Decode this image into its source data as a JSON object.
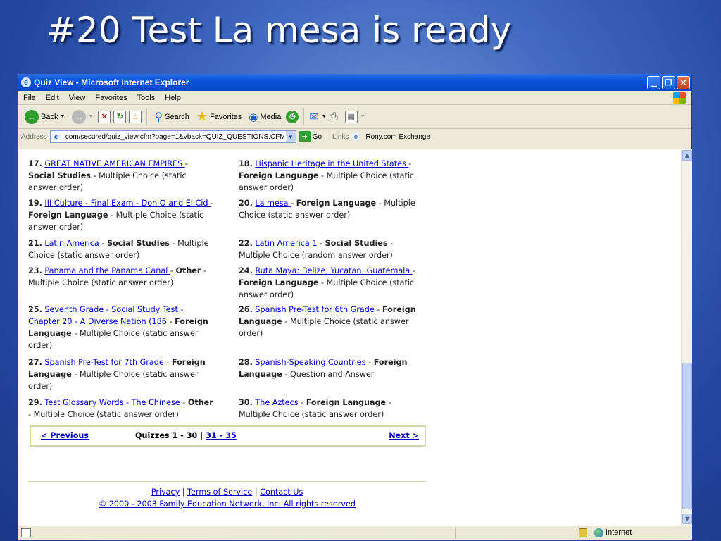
{
  "slide": {
    "title": "#20 Test La mesa is ready"
  },
  "window": {
    "title": "Quiz View - Microsoft Internet Explorer"
  },
  "menu": [
    "File",
    "Edit",
    "View",
    "Favorites",
    "Tools",
    "Help"
  ],
  "toolbar": {
    "back": "Back",
    "search": "Search",
    "favorites": "Favorites",
    "media": "Media"
  },
  "address": {
    "label": "Address",
    "url": "com/secured/quiz_view.cfm?page=1&vback=QUIZ_QUESTIONS.CFM",
    "go": "Go",
    "links": "Links",
    "exchange": "Rony.com Exchange"
  },
  "quizzes": [
    {
      "num": "17.",
      "title": "GREAT NATIVE AMERICAN EMPIRES ",
      "subject": "Social Studies",
      "type": "Multiple Choice (static answer order)"
    },
    {
      "num": "18.",
      "title": "Hispanic Heritage in the United States ",
      "subject": "Foreign Language",
      "type": "Multiple Choice (static answer order)"
    },
    {
      "num": "19.",
      "title": "III Culture - Final Exam - Don Q and El Cid ",
      "subject": "Foreign Language",
      "type": "Multiple Choice (static answer order)"
    },
    {
      "num": "20.",
      "title": "La mesa ",
      "subject": "Foreign Language",
      "type": "Multiple Choice (static answer order)"
    },
    {
      "num": "21.",
      "title": "Latin America ",
      "subject": "Social Studies",
      "type": "Multiple Choice (static answer order)"
    },
    {
      "num": "22.",
      "title": "Latin America 1 ",
      "subject": "Social Studies",
      "type": "Multiple Choice (random answer order)"
    },
    {
      "num": "23.",
      "title": "Panama and the Panama Canal ",
      "subject": "Other",
      "type": "Multiple Choice (static answer order)"
    },
    {
      "num": "24.",
      "title": "Ruta Maya: Belize, Yucatan, Guatemala ",
      "subject": "Foreign Language",
      "type": "Multiple Choice (static answer order)"
    },
    {
      "num": "25.",
      "title": "Seventh Grade - Social Study Test - Chapter 20 - A Diverse Nation (186 ",
      "subject": "Foreign Language",
      "type": "Multiple Choice (static answer order)"
    },
    {
      "num": "26.",
      "title": "Spanish Pre-Test for 6th Grade ",
      "subject": "Foreign Language",
      "type": "Multiple Choice (static answer order)"
    },
    {
      "num": "27.",
      "title": "Spanish Pre-Test for 7th Grade ",
      "subject": "Foreign Language",
      "type": "Multiple Choice (static answer order)"
    },
    {
      "num": "28.",
      "title": "Spanish-Speaking Countries ",
      "subject": "Foreign Language",
      "type": "Question and Answer"
    },
    {
      "num": "29.",
      "title": "Test Glossary Words - The Chinese ",
      "subject": "Other",
      "type": "Multiple Choice (static answer order)"
    },
    {
      "num": "30.",
      "title": "The Aztecs ",
      "subject": "Foreign Language",
      "type": "Multiple Choice (static answer order)"
    }
  ],
  "sep": "-",
  "pager": {
    "prev": "< Previous",
    "range": "Quizzes 1 - 30 |",
    "range_link": "31 - 35",
    "next": "Next >"
  },
  "footer": {
    "privacy": "Privacy",
    "terms": "Terms of Service",
    "contact": "Contact Us",
    "bar": "|",
    "copyright": "© 2000 - 2003 Family Education Network, Inc. All rights reserved"
  },
  "status": {
    "zone": "Internet"
  }
}
